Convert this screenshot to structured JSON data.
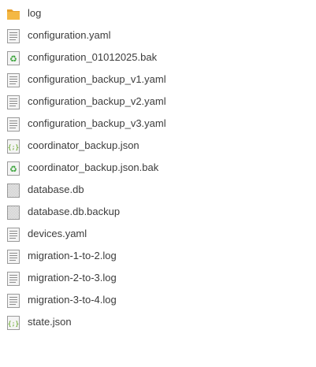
{
  "files": [
    {
      "name": "log",
      "icon": "folder-icon"
    },
    {
      "name": "configuration.yaml",
      "icon": "text-file-icon"
    },
    {
      "name": "configuration_01012025.bak",
      "icon": "recycle-file-icon"
    },
    {
      "name": "configuration_backup_v1.yaml",
      "icon": "text-file-icon"
    },
    {
      "name": "configuration_backup_v2.yaml",
      "icon": "text-file-icon"
    },
    {
      "name": "configuration_backup_v3.yaml",
      "icon": "text-file-icon"
    },
    {
      "name": "coordinator_backup.json",
      "icon": "json-file-icon"
    },
    {
      "name": "coordinator_backup.json.bak",
      "icon": "recycle-file-icon"
    },
    {
      "name": "database.db",
      "icon": "binary-file-icon"
    },
    {
      "name": "database.db.backup",
      "icon": "binary-file-icon"
    },
    {
      "name": "devices.yaml",
      "icon": "text-file-icon"
    },
    {
      "name": "migration-1-to-2.log",
      "icon": "text-file-icon"
    },
    {
      "name": "migration-2-to-3.log",
      "icon": "text-file-icon"
    },
    {
      "name": "migration-3-to-4.log",
      "icon": "text-file-icon"
    },
    {
      "name": "state.json",
      "icon": "json-file-icon"
    }
  ],
  "colors": {
    "folder": "#f4b844",
    "folder_dark": "#e8a02c",
    "file_border": "#9a9a9a",
    "file_lines": "#8c8c8c",
    "recycle": "#3aa33a",
    "json_brace": "#4e9a06",
    "text": "#3c3c3c"
  }
}
